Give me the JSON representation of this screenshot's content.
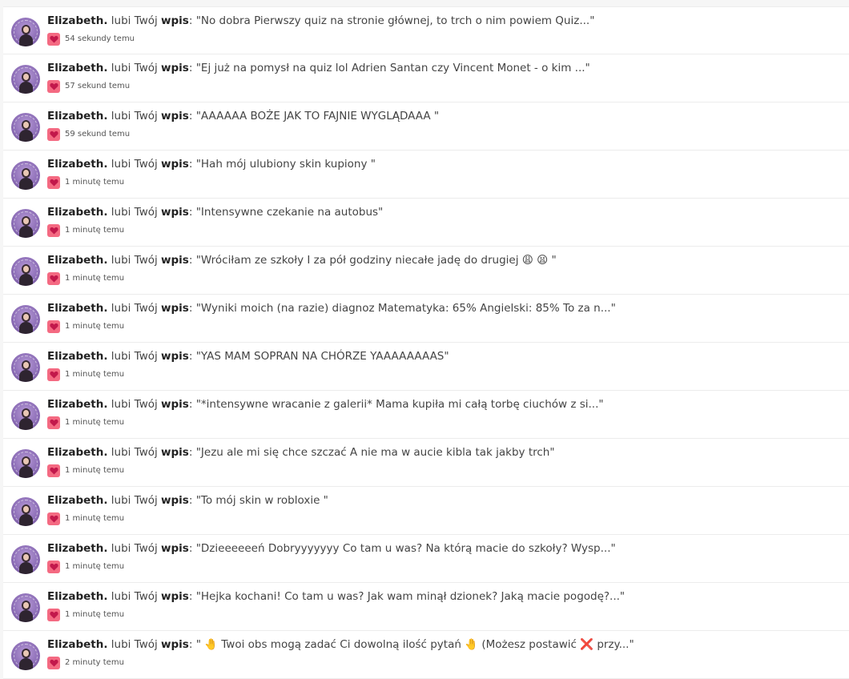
{
  "notifications": [
    {
      "user": "Elizabeth.",
      "action": "lubi Twój",
      "object": "wpis",
      "quote": ": \"No dobra Pierwszy quiz na stronie głównej, to trch o nim powiem Quiz...\"",
      "time": "54 sekundy temu"
    },
    {
      "user": "Elizabeth.",
      "action": "lubi Twój",
      "object": "wpis",
      "quote": ": \"Ej już na pomysł na quiz lol Adrien Santan czy Vincent Monet - o kim ...\"",
      "time": "57 sekund temu"
    },
    {
      "user": "Elizabeth.",
      "action": "lubi Twój",
      "object": "wpis",
      "quote": ": \"AAAAAA BOŻE JAK TO FAJNIE WYGLĄDAAA \"",
      "time": "59 sekund temu"
    },
    {
      "user": "Elizabeth.",
      "action": "lubi Twój",
      "object": "wpis",
      "quote": ": \"Hah mój ulubiony skin kupiony \"",
      "time": "1 minutę temu"
    },
    {
      "user": "Elizabeth.",
      "action": "lubi Twój",
      "object": "wpis",
      "quote": ": \"Intensywne czekanie na autobus\"",
      "time": "1 minutę temu"
    },
    {
      "user": "Elizabeth.",
      "action": "lubi Twój",
      "object": "wpis",
      "quote": ": \"Wróciłam ze szkoły I za pół godziny niecałe jadę do drugiej 😩 😫 \"",
      "time": "1 minutę temu"
    },
    {
      "user": "Elizabeth.",
      "action": "lubi Twój",
      "object": "wpis",
      "quote": ": \"Wyniki moich (na razie) diagnoz Matematyka: 65% Angielski: 85% To za n...\"",
      "time": "1 minutę temu"
    },
    {
      "user": "Elizabeth.",
      "action": "lubi Twój",
      "object": "wpis",
      "quote": ": \"YAS MAM SOPRAN NA CHÓRZE YAAAAAAAAS\"",
      "time": "1 minutę temu"
    },
    {
      "user": "Elizabeth.",
      "action": "lubi Twój",
      "object": "wpis",
      "quote": ": \"*intensywne wracanie z galerii* Mama kupiła mi całą torbę ciuchów z si...\"",
      "time": "1 minutę temu"
    },
    {
      "user": "Elizabeth.",
      "action": "lubi Twój",
      "object": "wpis",
      "quote": ": \"Jezu ale mi się chce szczać A nie ma w aucie kibla tak jakby trch\"",
      "time": "1 minutę temu"
    },
    {
      "user": "Elizabeth.",
      "action": "lubi Twój",
      "object": "wpis",
      "quote": ": \"To mój skin w robloxie \"",
      "time": "1 minutę temu"
    },
    {
      "user": "Elizabeth.",
      "action": "lubi Twój",
      "object": "wpis",
      "quote": ": \"Dzieeeeeeń Dobryyyyyyy Co tam u was? Na którą macie do szkoły? Wysp...\"",
      "time": "1 minutę temu"
    },
    {
      "user": "Elizabeth.",
      "action": "lubi Twój",
      "object": "wpis",
      "quote": ": \"Hejka kochani! Co tam u was? Jak wam minął dzionek? Jaką macie pogodę?...\"",
      "time": "1 minutę temu"
    },
    {
      "user": "Elizabeth.",
      "action": "lubi Twój",
      "object": "wpis",
      "quote": ": \" 🤚 Twoi obs mogą zadać Ci dowolną ilość pytań 🤚  (Możesz postawić ❌ przy...\"",
      "time": "2 minuty temu"
    }
  ],
  "icons": {
    "avatar": "avatar",
    "like": "heart-icon"
  },
  "colors": {
    "like_badge": "#f46a82",
    "heart": "#c2184b"
  }
}
